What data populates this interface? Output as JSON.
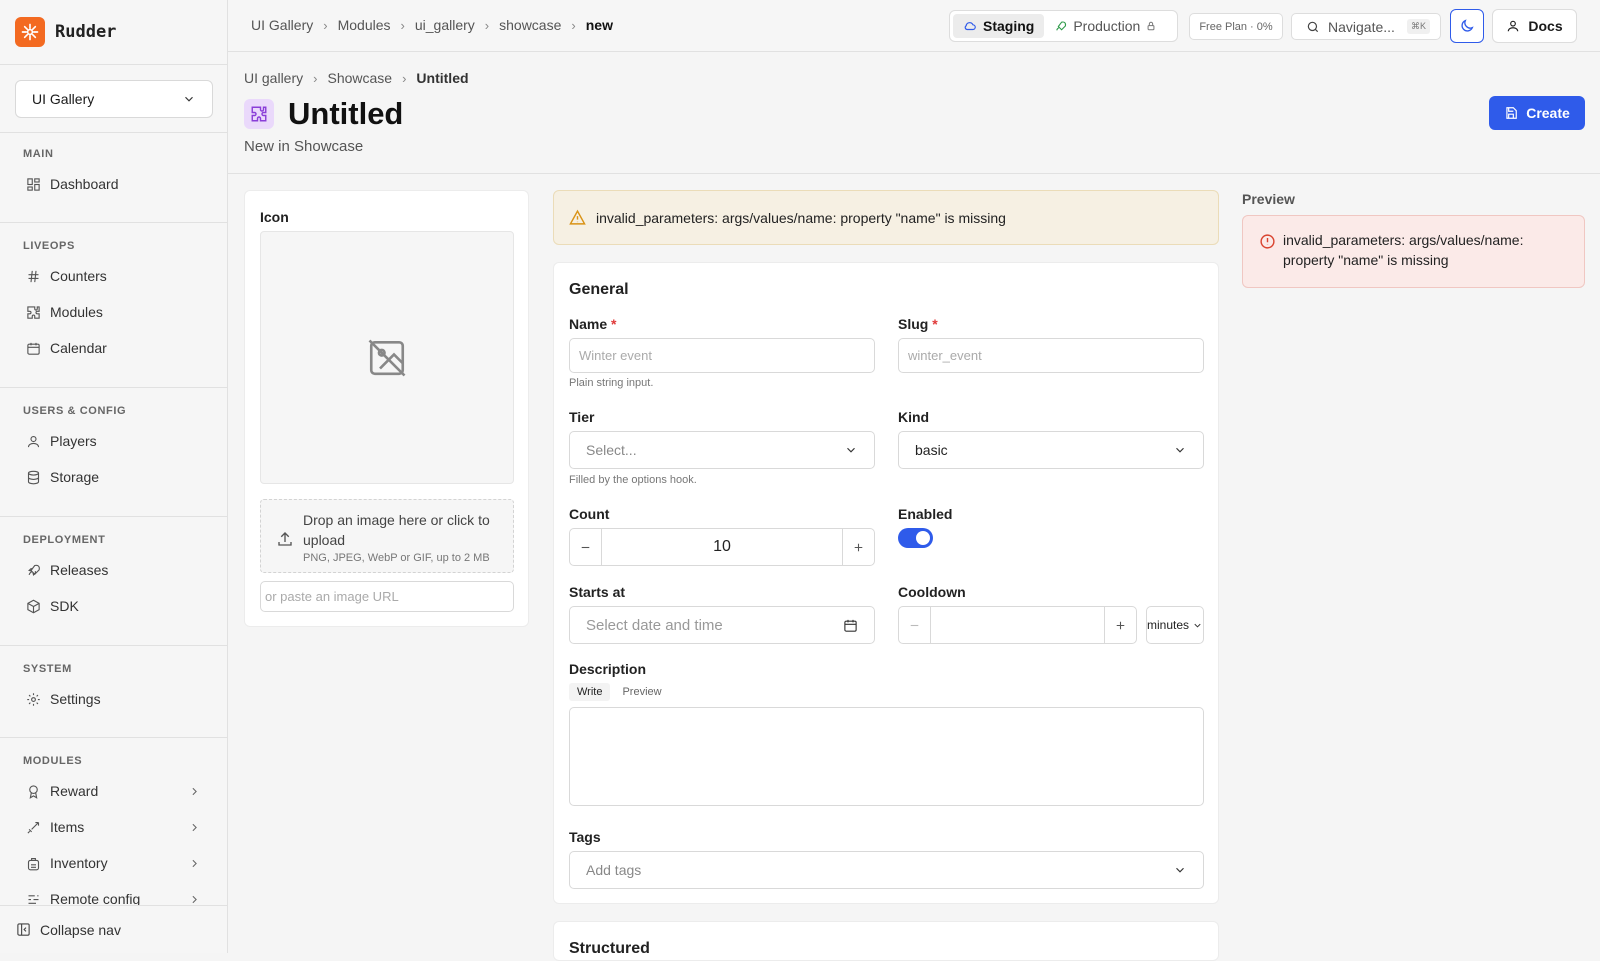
{
  "brand": {
    "name": "Rudder"
  },
  "sidebar": {
    "app_select": "UI Gallery",
    "sections": {
      "main": "MAIN",
      "liveops": "LIVEOPS",
      "users_config": "USERS & CONFIG",
      "deployment": "DEPLOYMENT",
      "system": "SYSTEM",
      "modules": "MODULES"
    },
    "items": {
      "dashboard": "Dashboard",
      "counters": "Counters",
      "modules": "Modules",
      "calendar": "Calendar",
      "players": "Players",
      "storage": "Storage",
      "releases": "Releases",
      "sdk": "SDK",
      "settings": "Settings",
      "reward": "Reward",
      "items": "Items",
      "inventory": "Inventory",
      "remote_config": "Remote config"
    },
    "collapse": "Collapse nav"
  },
  "topbar": {
    "breadcrumb": [
      "UI Gallery",
      "Modules",
      "ui_gallery",
      "showcase",
      "new"
    ],
    "env_staging": "Staging",
    "env_production": "Production",
    "plan": "Free Plan · 0%",
    "search": "Navigate...",
    "search_kbd": "⌘K",
    "docs": "Docs"
  },
  "page": {
    "breadcrumb": [
      "UI gallery",
      "Showcase",
      "Untitled"
    ],
    "title": "Untitled",
    "subtitle": "New in Showcase",
    "create": "Create"
  },
  "icon_card": {
    "label": "Icon",
    "drop_text": "Drop an image here or click to upload",
    "drop_hint": "PNG, JPEG, WebP or GIF, up to 2 MB",
    "url_placeholder": "or paste an image URL"
  },
  "warning": "invalid_parameters: args/values/name: property \"name\" is missing",
  "preview": {
    "label": "Preview",
    "error": "invalid_parameters: args/values/name: property \"name\" is missing"
  },
  "general": {
    "heading": "General",
    "name_label": "Name",
    "name_placeholder": "Winter event",
    "name_help": "Plain string input.",
    "slug_label": "Slug",
    "slug_placeholder": "winter_event",
    "tier_label": "Tier",
    "tier_placeholder": "Select...",
    "tier_help": "Filled by the options hook.",
    "kind_label": "Kind",
    "kind_value": "basic",
    "count_label": "Count",
    "count_value": "10",
    "enabled_label": "Enabled",
    "enabled": true,
    "starts_label": "Starts at",
    "starts_placeholder": "Select date and time",
    "cooldown_label": "Cooldown",
    "cooldown_unit": "minutes",
    "description_label": "Description",
    "tab_write": "Write",
    "tab_preview": "Preview",
    "tags_label": "Tags",
    "tags_placeholder": "Add tags"
  },
  "structured": {
    "heading": "Structured"
  }
}
